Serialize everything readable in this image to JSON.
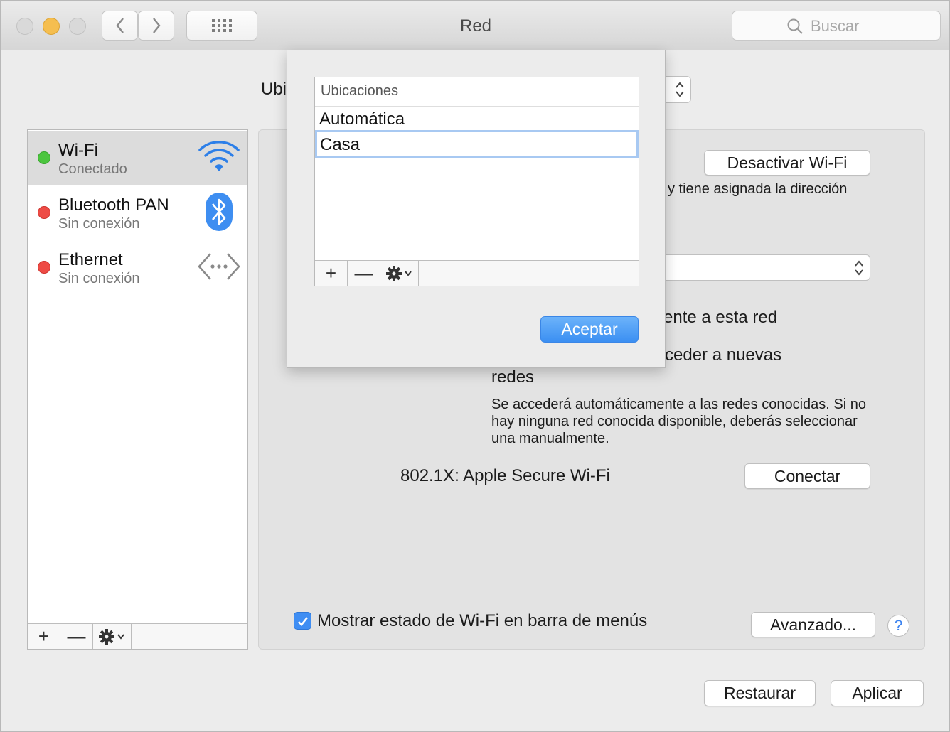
{
  "window": {
    "title": "Red"
  },
  "toolbar": {
    "search_placeholder": "Buscar"
  },
  "location": {
    "label": "Ubicación:"
  },
  "sidebar": {
    "items": [
      {
        "name": "Wi-Fi",
        "status": "Conectado",
        "status_color": "#4bc53e",
        "icon": "wifi-icon"
      },
      {
        "name": "Bluetooth PAN",
        "status": "Sin conexión",
        "status_color": "#ee4b45",
        "icon": "bluetooth-icon"
      },
      {
        "name": "Ethernet",
        "status": "Sin conexión",
        "status_color": "#ee4b45",
        "icon": "ethernet-icon"
      }
    ],
    "add_label": "+",
    "remove_label": "—"
  },
  "panel": {
    "wifi_off_button": "Desactivar Wi-Fi",
    "status_fragment": "i y tiene asignada la dirección",
    "auto_join_fragment": "ente a esta red",
    "ask_join_fragment": "ceder a nuevas",
    "ask_join_fragment_2": "redes",
    "ask_info_1": "Se accederá automáticamente a las redes conocidas. Si no",
    "ask_info_2": "hay ninguna red conocida disponible, deberás seleccionar",
    "ask_info_3": "una manualmente.",
    "dot1x_label": "802.1X:  Apple Secure Wi-Fi",
    "connect_button": "Conectar",
    "show_status_label": "Mostrar estado de Wi-Fi en barra de menús",
    "advanced_button": "Avanzado...",
    "help_label": "?"
  },
  "footer": {
    "revert_button": "Restaurar",
    "apply_button": "Aplicar"
  },
  "sheet": {
    "list_header": "Ubicaciones",
    "locations": [
      "Automática",
      "Casa"
    ],
    "selected": "Casa",
    "add_label": "+",
    "remove_label": "—",
    "ok_button": "Aceptar"
  },
  "colors": {
    "accent": "#3b8ff2",
    "selection_outline": "#a8c9f2"
  }
}
